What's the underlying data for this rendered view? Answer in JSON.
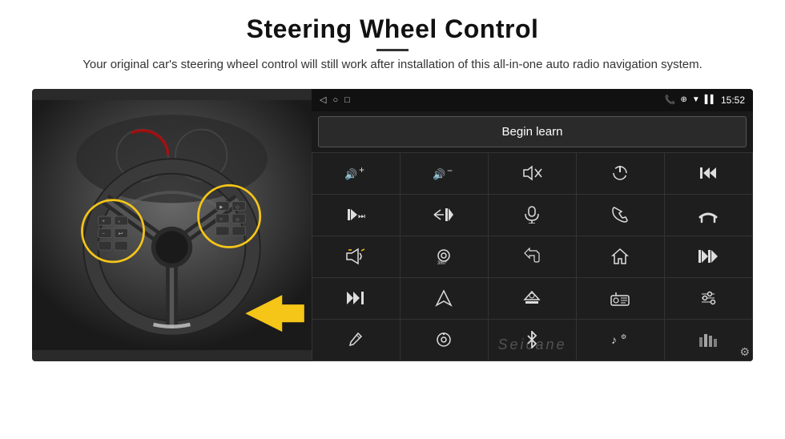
{
  "page": {
    "title": "Steering Wheel Control",
    "subtitle": "Your original car's steering wheel control will still work after installation of this all-in-one auto radio navigation system.",
    "divider": "—"
  },
  "android_ui": {
    "begin_learn_label": "Begin learn",
    "time": "15:52",
    "watermark": "Seicane",
    "nav_icons": [
      "◁",
      "○",
      "□"
    ],
    "status_icons": [
      "📞",
      "⊕",
      "▼"
    ],
    "icons": [
      {
        "id": "vol-up",
        "symbol": "🔊+",
        "label": "volume up"
      },
      {
        "id": "vol-down",
        "symbol": "🔊−",
        "label": "volume down"
      },
      {
        "id": "mute",
        "symbol": "🔇",
        "label": "mute"
      },
      {
        "id": "power",
        "symbol": "⏻",
        "label": "power"
      },
      {
        "id": "prev-track",
        "symbol": "⏮",
        "label": "previous track"
      },
      {
        "id": "skip-fwd",
        "symbol": "⏭",
        "label": "skip forward"
      },
      {
        "id": "prev",
        "symbol": "⏮",
        "label": "prev"
      },
      {
        "id": "mic",
        "symbol": "🎙",
        "label": "microphone"
      },
      {
        "id": "phone",
        "symbol": "📞",
        "label": "phone"
      },
      {
        "id": "hang-up",
        "symbol": "↩",
        "label": "hang up"
      },
      {
        "id": "horn",
        "symbol": "📢",
        "label": "horn"
      },
      {
        "id": "360",
        "symbol": "⊙",
        "label": "360 camera"
      },
      {
        "id": "back",
        "symbol": "↩",
        "label": "back"
      },
      {
        "id": "home",
        "symbol": "⌂",
        "label": "home"
      },
      {
        "id": "rewind",
        "symbol": "⏮⏮",
        "label": "rewind"
      },
      {
        "id": "next",
        "symbol": "⏭",
        "label": "next chapter"
      },
      {
        "id": "navigate",
        "symbol": "▲",
        "label": "navigate"
      },
      {
        "id": "eject",
        "symbol": "⏏",
        "label": "eject"
      },
      {
        "id": "radio",
        "symbol": "📻",
        "label": "radio"
      },
      {
        "id": "eq",
        "symbol": "⇅",
        "label": "equalizer"
      },
      {
        "id": "pen",
        "symbol": "✏",
        "label": "pen"
      },
      {
        "id": "settings-knob",
        "symbol": "⊙",
        "label": "settings knob"
      },
      {
        "id": "bluetooth",
        "symbol": "⚡",
        "label": "bluetooth"
      },
      {
        "id": "music",
        "symbol": "♪",
        "label": "music settings"
      },
      {
        "id": "waveform",
        "symbol": "▊▌▌▊",
        "label": "audio levels"
      }
    ]
  },
  "colors": {
    "background": "#ffffff",
    "android_bg": "#1a1a1a",
    "title_color": "#111111",
    "subtitle_color": "#333333",
    "button_bg": "#2a2a2a",
    "button_border": "#555555",
    "icon_color": "#dddddd",
    "yellow": "#f5c518",
    "grid_bg": "#1e1e1e",
    "grid_border": "#333333"
  }
}
